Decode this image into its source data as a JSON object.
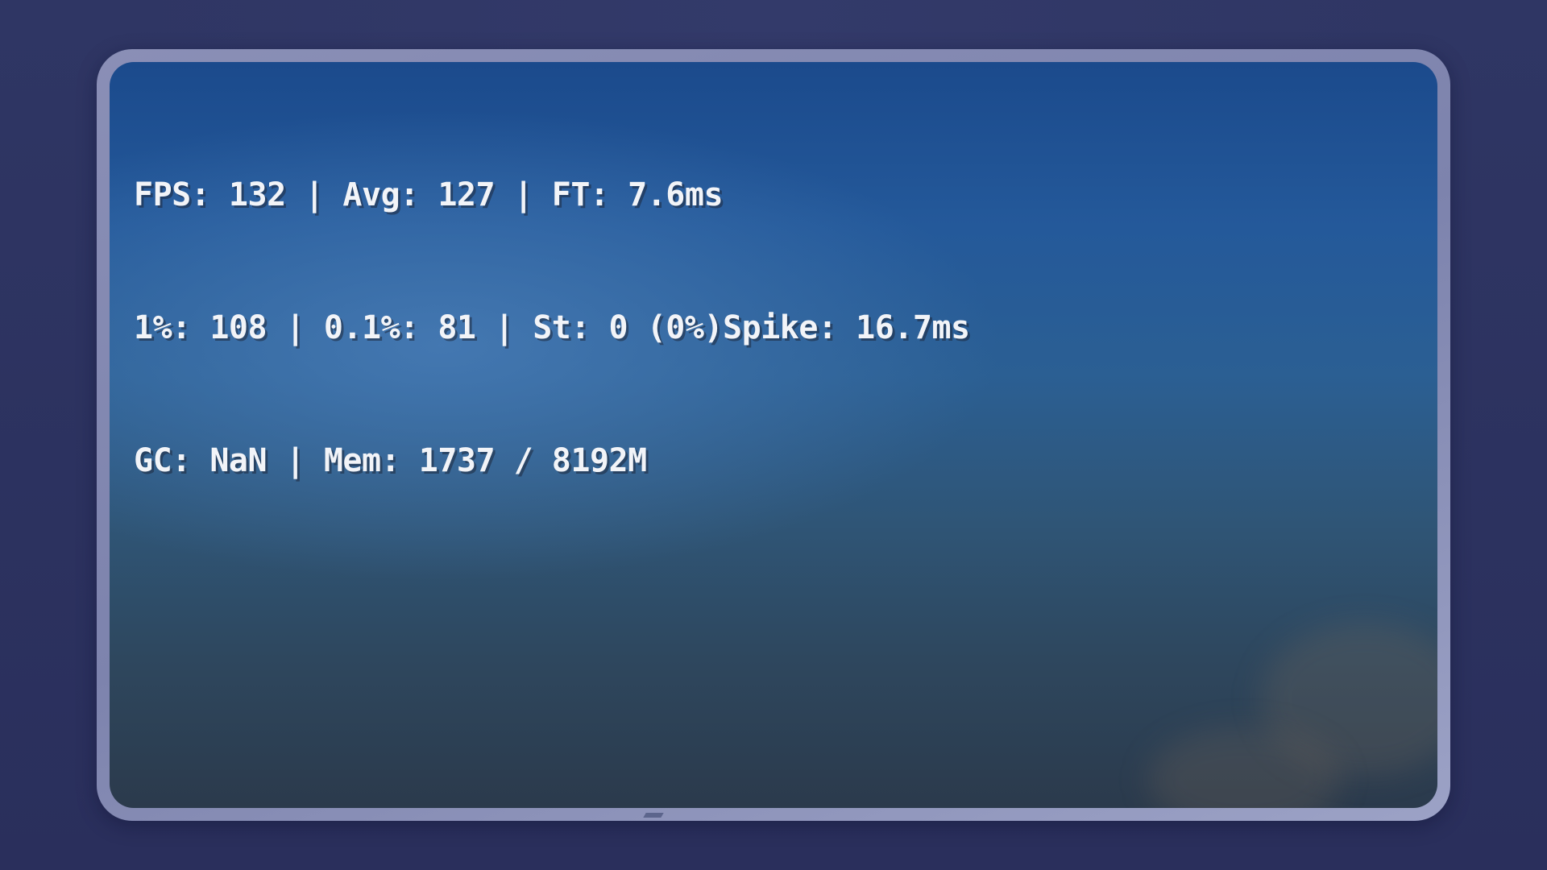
{
  "overlay": {
    "line1": "FPS: 132 | Avg: 127 | FT: 7.6ms",
    "line2": "1%: 108 | 0.1%: 81 | St: 0 (0%)Spike: 16.7ms",
    "line3": "GC: NaN | Mem: 1737 / 8192M"
  },
  "colors": {
    "page_background": "#2c3260",
    "frame_border": "#8a8fb6",
    "sky_top": "#1b4a8c",
    "sky_bottom": "#2b3a4c",
    "overlay_text": "#f2f4f8"
  }
}
